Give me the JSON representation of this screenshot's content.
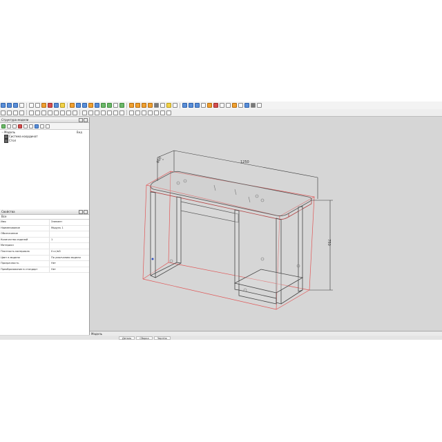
{
  "app": {
    "accent": "#f0a030",
    "bg": "#d6d6d6"
  },
  "left_panel": {
    "tree_title": "Структура модели",
    "tree_caption": "Вид",
    "tree": [
      {
        "label": "Модель",
        "indent": 0
      },
      {
        "label": "Система координат",
        "indent": 1
      },
      {
        "label": "Стол",
        "indent": 1
      }
    ],
    "props_title": "Свойства",
    "props_filter": "Все",
    "properties": [
      {
        "key": "Имя",
        "value": "Элемент"
      },
      {
        "key": "Наименование",
        "value": "Модуль 1"
      },
      {
        "key": "Обозначение",
        "value": ""
      },
      {
        "key": "Количество изделий",
        "value": "1"
      },
      {
        "key": "Материал",
        "value": ""
      },
      {
        "key": "Плотность материала",
        "value": "0 кг/м3"
      },
      {
        "key": "Цвет в модели",
        "value": "По умолчанию модели"
      },
      {
        "key": "Прозрачность",
        "value": "Нет"
      },
      {
        "key": "Преобразование в стандарт",
        "value": "Нет"
      }
    ]
  },
  "viewport": {
    "dim_width": "1250",
    "dim_height": "750",
    "dim_depth": "600"
  },
  "status": {
    "text": "Модель"
  },
  "taskbar": {
    "tabs": [
      "Деталь",
      "Сборка",
      "Чертёж"
    ]
  }
}
